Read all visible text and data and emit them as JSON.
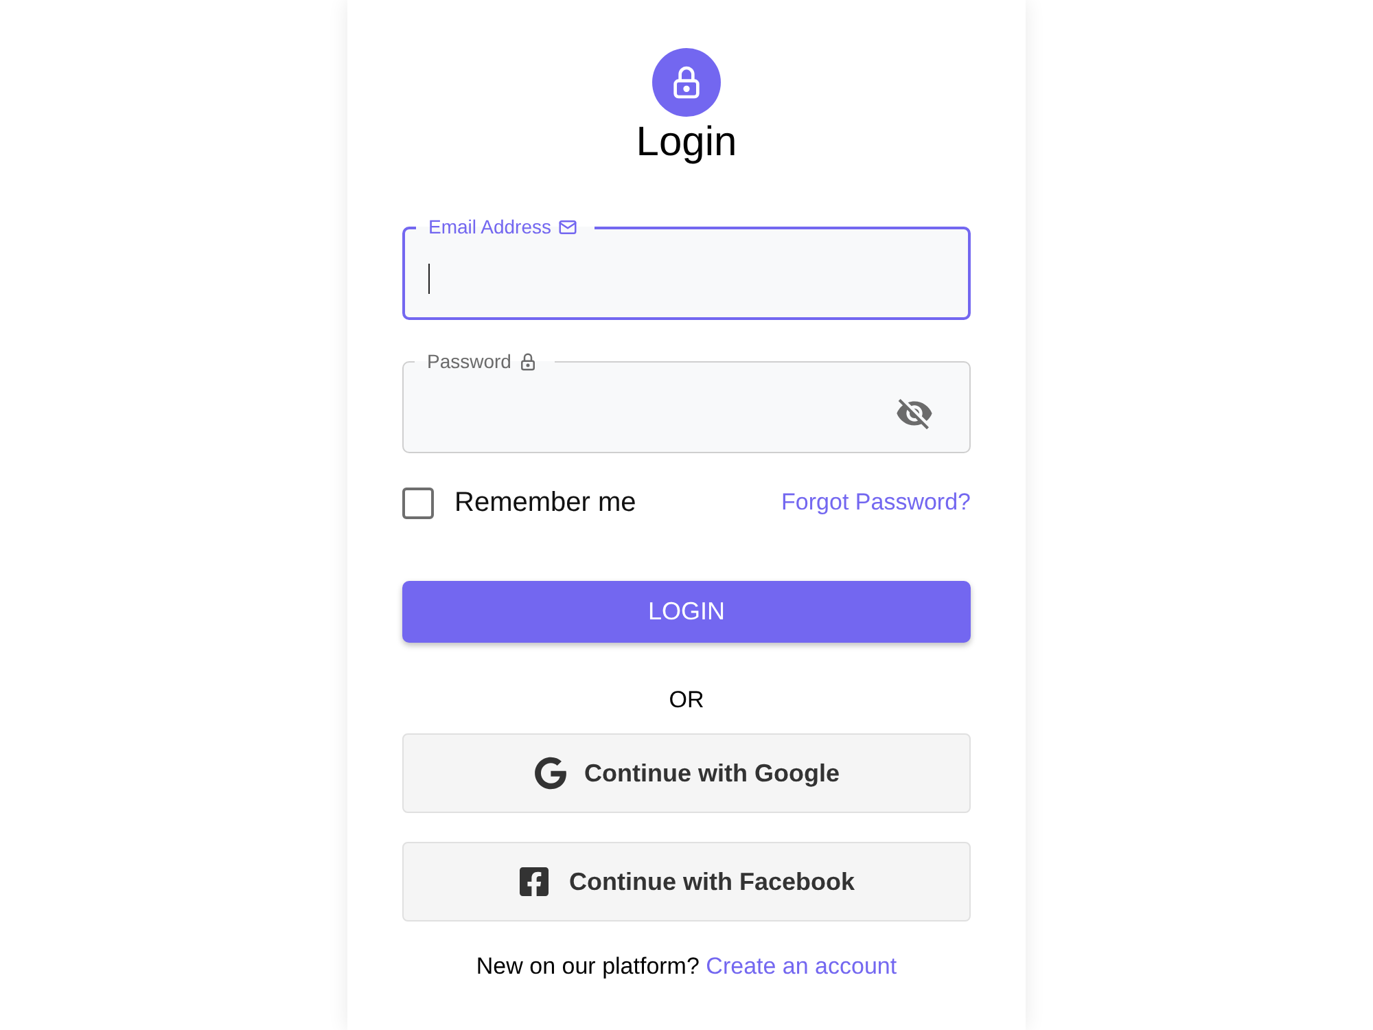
{
  "header": {
    "title": "Login"
  },
  "fields": [
    {
      "kind": "email",
      "label": "Email Address",
      "focused": true
    },
    {
      "kind": "password",
      "label": "Password",
      "focused": false
    }
  ],
  "remember": {
    "label": "Remember me",
    "checked": false
  },
  "forgot_link": "Forgot Password?",
  "login_button": "LOGIN",
  "divider": "OR",
  "social_buttons": [
    {
      "kind": "google",
      "label": "Continue with Google"
    },
    {
      "kind": "facebook",
      "label": "Continue with Facebook"
    }
  ],
  "footer": {
    "text": "New on our platform?",
    "link": "Create an account"
  }
}
